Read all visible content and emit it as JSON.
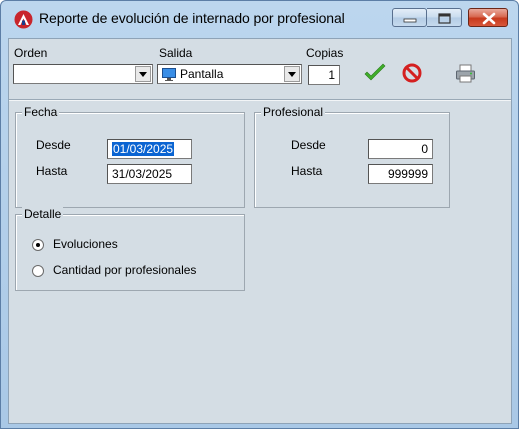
{
  "window": {
    "title": "Reporte de evolución de internado por profesional"
  },
  "toolbar": {
    "orden_label": "Orden",
    "orden_value": "",
    "salida_label": "Salida",
    "salida_value": "Pantalla",
    "copias_label": "Copias",
    "copias_value": "1"
  },
  "fecha": {
    "title": "Fecha",
    "desde_label": "Desde",
    "desde_value": "01/03/2025",
    "hasta_label": "Hasta",
    "hasta_value": "31/03/2025"
  },
  "profesional": {
    "title": "Profesional",
    "desde_label": "Desde",
    "desde_value": "0",
    "hasta_label": "Hasta",
    "hasta_value": "999999"
  },
  "detalle": {
    "title": "Detalle",
    "options": [
      {
        "label": "Evoluciones",
        "checked": true
      },
      {
        "label": "Cantidad por profesionales",
        "checked": false
      }
    ]
  },
  "colors": {
    "accept": "#3fae2a",
    "cancel": "#d42020",
    "selection": "#0a64d2"
  }
}
